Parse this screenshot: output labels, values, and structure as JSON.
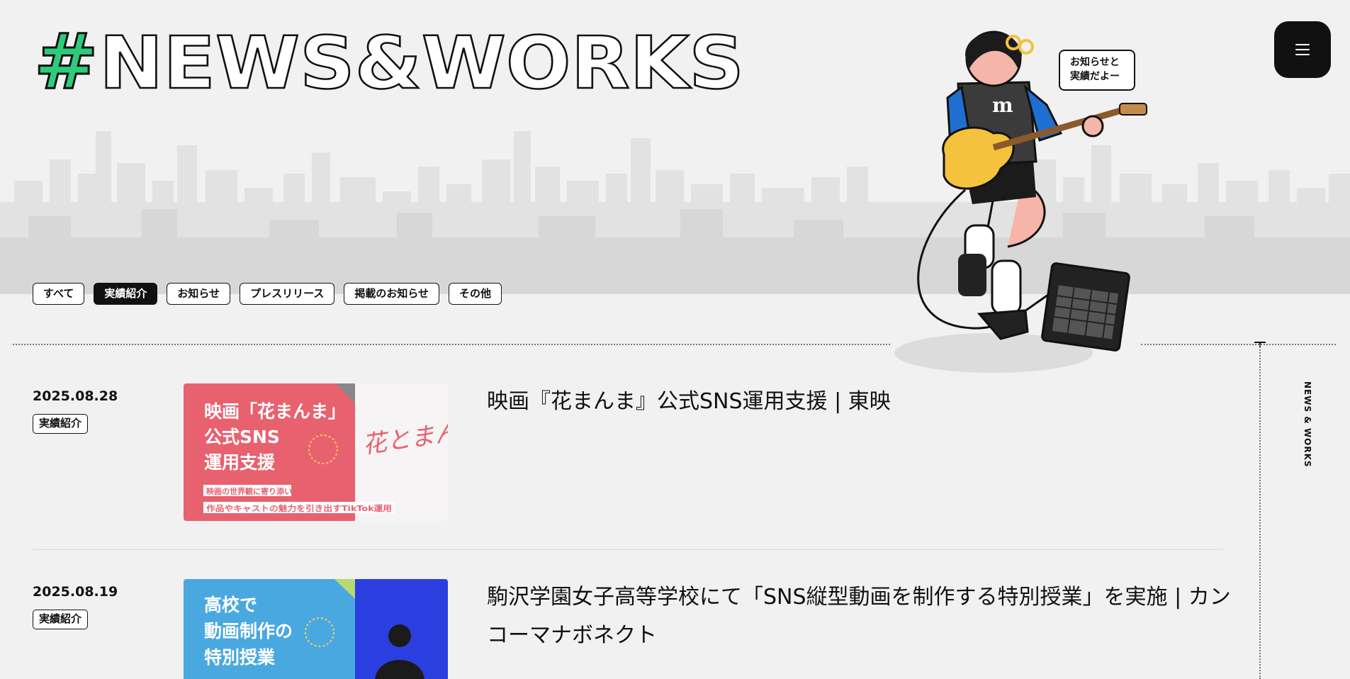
{
  "header": {
    "title": "#NEWS&WORKS",
    "hash": "#",
    "word": "NEWS&WORKS",
    "speech_bubble": [
      "お知らせと",
      "実績だよー"
    ],
    "menu_icon": "hamburger-icon"
  },
  "filters": [
    {
      "label": "すべて",
      "active": false
    },
    {
      "label": "実績紹介",
      "active": true
    },
    {
      "label": "お知らせ",
      "active": false
    },
    {
      "label": "プレスリリース",
      "active": false
    },
    {
      "label": "掲載のお知らせ",
      "active": false
    },
    {
      "label": "その他",
      "active": false
    }
  ],
  "side_label": "NEWS & WORKS",
  "articles": [
    {
      "date": "2025.08.28",
      "tag": "実績紹介",
      "title": "映画『花まんま』公式SNS運用支援 | 東映",
      "thumb": {
        "color": "#e8616f",
        "heading": [
          "映画「花まんま」",
          "公式SNS",
          "運用支援"
        ],
        "sub": [
          "映画の世界観に寄り添い、",
          "作品やキャストの魅力を引き出すTikTok運用"
        ],
        "logo": "花とまんま"
      }
    },
    {
      "date": "2025.08.19",
      "tag": "実績紹介",
      "title": "駒沢学園女子高等学校にて「SNS縦型動画を制作する特別授業」を実施 | カンコーマナボネクト",
      "thumb": {
        "color": "#4aa8e0",
        "heading": [
          "高校で",
          "動画制作の",
          "特別授業"
        ]
      }
    }
  ],
  "colors": {
    "accent_green": "#2ecc7a",
    "ink": "#111111",
    "background": "#f1f1f1"
  }
}
